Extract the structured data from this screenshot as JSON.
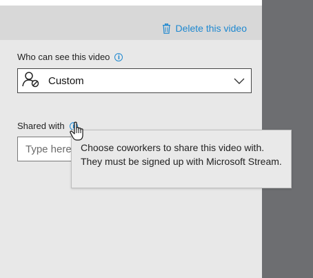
{
  "header": {
    "delete_label": "Delete this video",
    "delete_icon": "trash-icon"
  },
  "visibility": {
    "label": "Who can see this video",
    "selected": "Custom",
    "select_icon": "custom-permission-icon"
  },
  "sharing": {
    "label": "Shared with",
    "placeholder": "Type here",
    "tooltip": "Choose coworkers to share this video with. They must be signed up with Microsoft Stream."
  },
  "colors": {
    "accent": "#1e88d0",
    "panel": "#e8e8e8",
    "header_band": "#d8d8d8",
    "gutter": "#6d6e71"
  }
}
